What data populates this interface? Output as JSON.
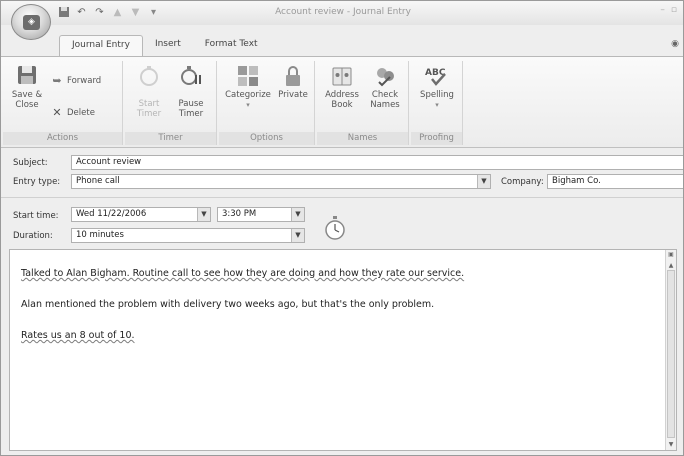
{
  "window": {
    "title": "Account review - Journal Entry"
  },
  "quick_access": {
    "icons": [
      "save-icon",
      "undo-icon",
      "redo-icon",
      "up-icon",
      "down-icon",
      "customize-icon"
    ]
  },
  "tabs": [
    {
      "label": "Journal Entry",
      "active": true
    },
    {
      "label": "Insert",
      "active": false
    },
    {
      "label": "Format Text",
      "active": false
    }
  ],
  "ribbon": {
    "actions": {
      "group_label": "Actions",
      "save_close": "Save &\nClose",
      "forward": "Forward",
      "delete": "Delete"
    },
    "timer": {
      "group_label": "Timer",
      "start_timer": "Start\nTimer",
      "pause_timer": "Pause\nTimer"
    },
    "options": {
      "group_label": "Options",
      "categorize": "Categorize",
      "private": "Private"
    },
    "names": {
      "group_label": "Names",
      "address_book": "Address\nBook",
      "check_names": "Check\nNames"
    },
    "proofing": {
      "group_label": "Proofing",
      "spelling": "Spelling"
    }
  },
  "form": {
    "subject_label": "Subject:",
    "subject_value": "Account review",
    "entry_type_label": "Entry type:",
    "entry_type_value": "Phone call",
    "company_label": "Company:",
    "company_value": "Bigham Co.",
    "start_time_label": "Start time:",
    "start_date_value": "Wed 11/22/2006",
    "start_time_value": "3:30 PM",
    "duration_label": "Duration:",
    "duration_value": "10 minutes"
  },
  "body": {
    "paragraphs": [
      "Talked to Alan Bigham. Routine call to see how they are doing and how they rate our service.",
      "Alan mentioned the problem with delivery two weeks ago, but that's the only problem.",
      "Rates us an 8 out of 10."
    ]
  },
  "colors": {
    "window_bg": "#eeeeee",
    "ribbon_bg": "#f4f4f4",
    "field_border": "#b0b0b0",
    "group_label": "#8a8a8a"
  }
}
